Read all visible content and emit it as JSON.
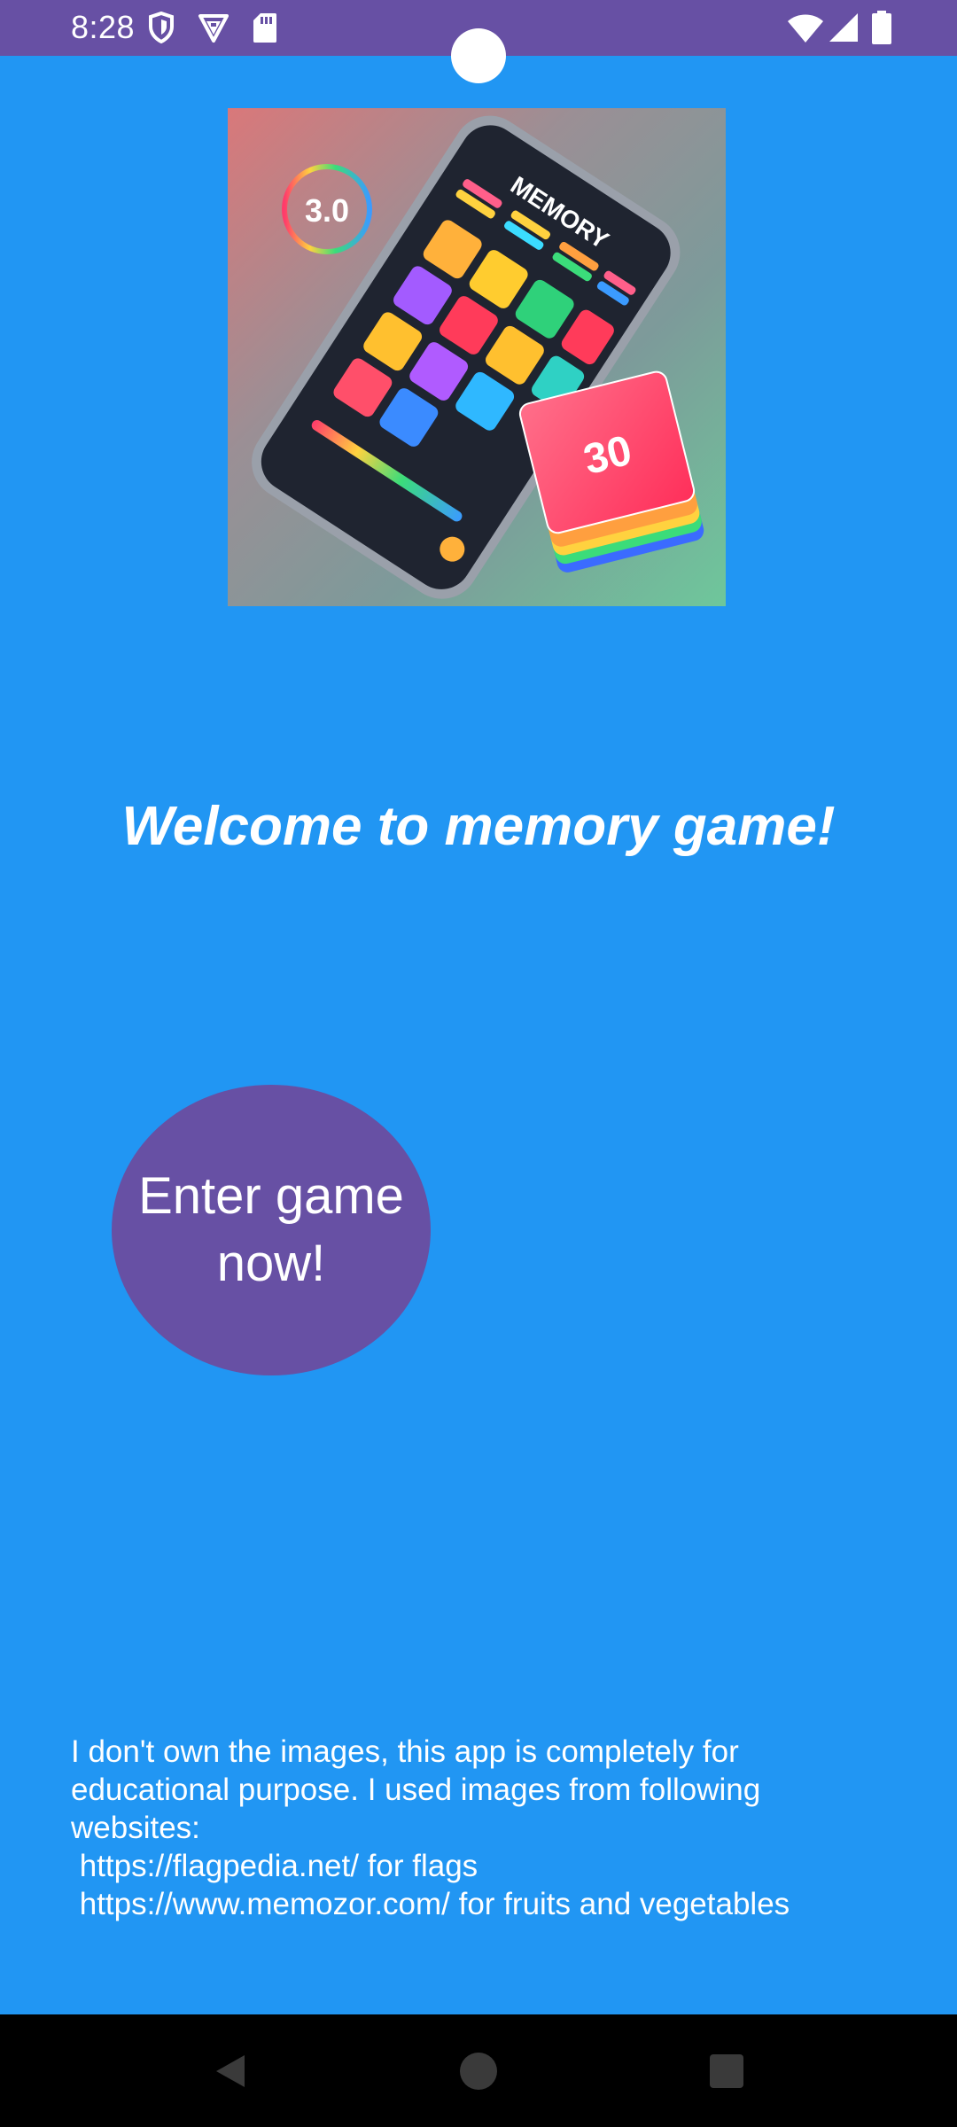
{
  "status_bar": {
    "time": "8:28",
    "icons_left": [
      "shield-icon",
      "location-icon",
      "sd-card-icon"
    ],
    "icons_right": [
      "wifi-icon",
      "cellular-signal-icon",
      "battery-icon"
    ]
  },
  "hero_image": {
    "title": "MEMORY",
    "badge_text": "3.0",
    "card_text": "30"
  },
  "welcome": {
    "title": "Welcome to memory game!"
  },
  "enter_button": {
    "line1": "Enter game",
    "line2": "now!"
  },
  "disclaimer": {
    "lines": [
      "I don't own the images, this app is completely for",
      "educational purpose. I used images from following",
      "websites:",
      " https://flagpedia.net/ for flags",
      " https://www.memozor.com/ for fruits and vegetables"
    ]
  },
  "nav_bar": {
    "buttons": [
      "back-icon",
      "home-icon",
      "recents-icon"
    ]
  },
  "colors": {
    "background": "#2196F3",
    "status_bar": "#6750A4",
    "button": "#6750A4",
    "text": "#FFFFFF",
    "nav_bar": "#000000"
  }
}
